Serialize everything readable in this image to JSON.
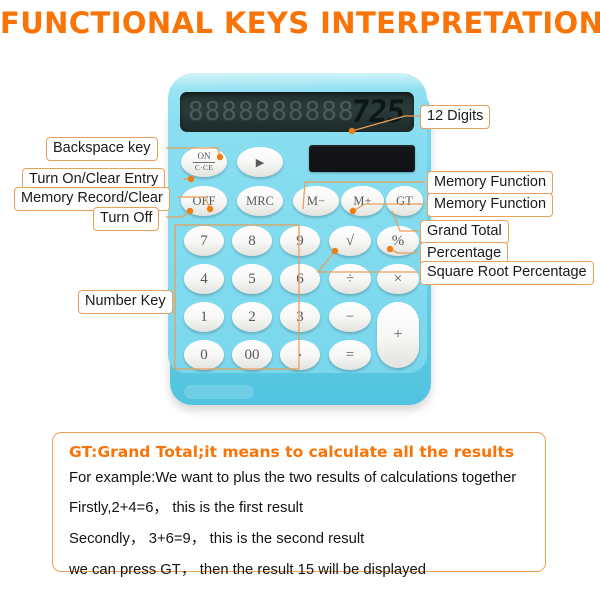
{
  "page": {
    "title": "FUNCTIONAL KEYS INTERPRETATION",
    "title_color": "#f97306",
    "background": "#ffffff"
  },
  "calculator": {
    "body_color": "#7fdaee",
    "key_color": "#f7f7f5",
    "display": {
      "value": "725",
      "ghost_digits": "8888888888",
      "panel_color": "#253433"
    },
    "solar_panel": {
      "color": "#15161a"
    },
    "function_keys": [
      {
        "id": "on-cce",
        "label_top": "ON",
        "label_bottom": "C·CE"
      },
      {
        "id": "backspace",
        "label": "▶"
      },
      {
        "id": "off",
        "label": "OFF"
      },
      {
        "id": "mrc",
        "label": "MRC"
      },
      {
        "id": "m-minus",
        "label": "M−"
      },
      {
        "id": "m-plus",
        "label": "M+"
      },
      {
        "id": "gt",
        "label": "GT"
      }
    ],
    "number_keys": [
      {
        "id": "7",
        "label": "7"
      },
      {
        "id": "8",
        "label": "8"
      },
      {
        "id": "9",
        "label": "9"
      },
      {
        "id": "4",
        "label": "4"
      },
      {
        "id": "5",
        "label": "5"
      },
      {
        "id": "6",
        "label": "6"
      },
      {
        "id": "1",
        "label": "1"
      },
      {
        "id": "2",
        "label": "2"
      },
      {
        "id": "3",
        "label": "3"
      },
      {
        "id": "0",
        "label": "0"
      },
      {
        "id": "00",
        "label": "00"
      },
      {
        "id": "decimal",
        "label": "·"
      }
    ],
    "operator_keys": [
      {
        "id": "sqrt",
        "label": "√"
      },
      {
        "id": "percent",
        "label": "%"
      },
      {
        "id": "divide",
        "label": "÷"
      },
      {
        "id": "multiply",
        "label": "×"
      },
      {
        "id": "minus",
        "label": "−"
      },
      {
        "id": "equals",
        "label": "="
      },
      {
        "id": "plus",
        "label": "+"
      }
    ]
  },
  "callouts": {
    "left": [
      {
        "id": "backspace-key",
        "label": "Backspace key"
      },
      {
        "id": "turn-on-clear-entry",
        "label": "Turn On/Clear Entry"
      },
      {
        "id": "memory-record-clear",
        "label": "Memory Record/Clear"
      },
      {
        "id": "turn-off",
        "label": "Turn Off"
      },
      {
        "id": "number-key",
        "label": "Number Key"
      }
    ],
    "right": [
      {
        "id": "12-digits",
        "label": "12 Digits"
      },
      {
        "id": "memory-function-1",
        "label": "Memory Function"
      },
      {
        "id": "memory-function-2",
        "label": "Memory Function"
      },
      {
        "id": "grand-total",
        "label": "Grand Total"
      },
      {
        "id": "percentage",
        "label": "Percentage"
      },
      {
        "id": "square-root-percentage",
        "label": "Square Root Percentage"
      }
    ],
    "border_color": "#e8a05a",
    "leader_color": "#e8a05a"
  },
  "gt_box": {
    "heading": "GT:Grand Total;it means to calculate all the results",
    "heading_color": "#f97306",
    "border_color": "#f0a050",
    "lines": [
      "For example:We want to plus the two  results of calculations together",
      "Firstly,2+4=6， this is the first result",
      "Secondly， 3+6=9， this is the second result",
      "we can press GT， then the result 15 will be displayed"
    ]
  }
}
